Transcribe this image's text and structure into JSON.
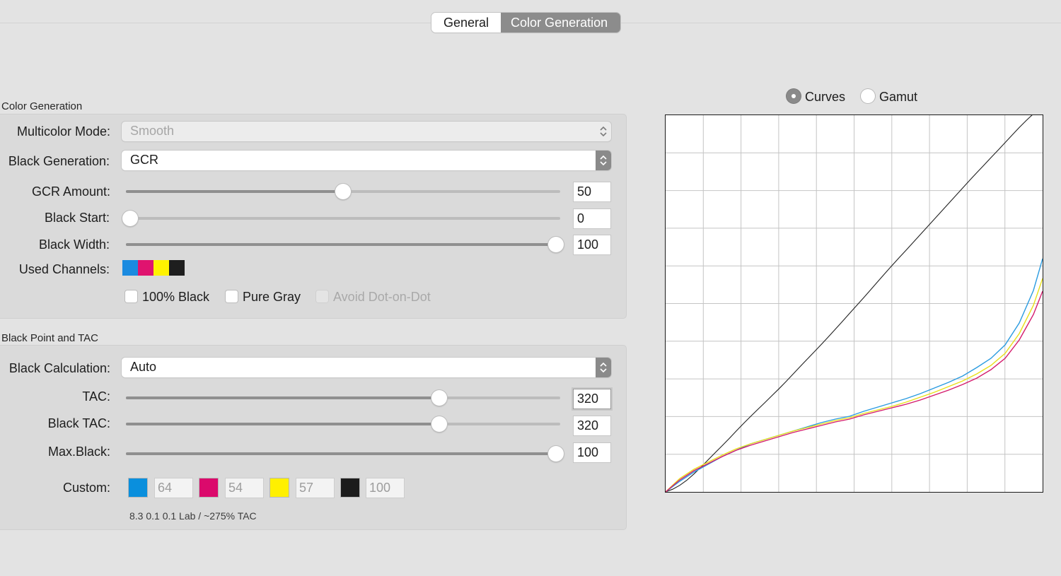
{
  "tabs": [
    {
      "label": "General",
      "active": false
    },
    {
      "label": "Color Generation",
      "active": true
    }
  ],
  "color_generation": {
    "title": "Color Generation",
    "multicolor_mode": {
      "label": "Multicolor Mode:",
      "value": "Smooth",
      "enabled": false
    },
    "black_generation": {
      "label": "Black Generation:",
      "value": "GCR"
    },
    "gcr_amount": {
      "label": "GCR Amount:",
      "value": "50",
      "level": 0.5
    },
    "black_start": {
      "label": "Black Start:",
      "value": "0",
      "level": 0.0
    },
    "black_width": {
      "label": "Black Width:",
      "value": "100",
      "level": 1.0
    },
    "used_channels": {
      "label": "Used Channels:",
      "colors": [
        "#1b8be0",
        "#e0136f",
        "#fff200",
        "#1e1e1e"
      ]
    },
    "checkboxes": [
      {
        "label": "100% Black",
        "checked": false,
        "enabled": true
      },
      {
        "label": "Pure Gray",
        "checked": false,
        "enabled": true
      },
      {
        "label": "Avoid Dot-on-Dot",
        "checked": false,
        "enabled": false
      }
    ]
  },
  "black_point": {
    "title": "Black Point and TAC",
    "black_calculation": {
      "label": "Black Calculation:",
      "value": "Auto"
    },
    "tac": {
      "label": "TAC:",
      "value": "320",
      "level": 0.726
    },
    "black_tac": {
      "label": "Black TAC:",
      "value": "320",
      "level": 0.726
    },
    "max_black": {
      "label": "Max.Black:",
      "value": "100",
      "level": 1.0
    },
    "custom": {
      "label": "Custom:",
      "channels": [
        {
          "name": "cyan",
          "color": "#0a8fdd",
          "value": "64"
        },
        {
          "name": "magenta",
          "color": "#db0a6c",
          "value": "54"
        },
        {
          "name": "yellow",
          "color": "#fff000",
          "value": "57"
        },
        {
          "name": "black",
          "color": "#1c1c1c",
          "value": "100"
        }
      ]
    },
    "note": "8.3 0.1 0.1 Lab / ~275% TAC"
  },
  "view_mode": {
    "options": [
      {
        "label": "Curves",
        "selected": true
      },
      {
        "label": "Gamut",
        "selected": false
      }
    ]
  },
  "curves_graph": {
    "grid_divisions": 10,
    "series": [
      {
        "color": "#222222",
        "points": [
          [
            0,
            0
          ],
          [
            10,
            3.8
          ],
          [
            20,
            9.3
          ],
          [
            30,
            16.5
          ],
          [
            40,
            25.3
          ],
          [
            50,
            35
          ],
          [
            60,
            45.2
          ],
          [
            70,
            55.4
          ],
          [
            80,
            65.4
          ],
          [
            90,
            75.6
          ],
          [
            100,
            86.2
          ],
          [
            110,
            96.6
          ],
          [
            120,
            106.6
          ],
          [
            130,
            116.4
          ],
          [
            140,
            126
          ],
          [
            150,
            135.9
          ],
          [
            160,
            145.7
          ],
          [
            170,
            155.9
          ],
          [
            180,
            166.5
          ],
          [
            190,
            177.1
          ],
          [
            200,
            187.6
          ],
          [
            210,
            198
          ],
          [
            220,
            208.5
          ],
          [
            230,
            219.3
          ],
          [
            240,
            230.3
          ],
          [
            250,
            241.3
          ],
          [
            260,
            252.5
          ],
          [
            270,
            263.6
          ],
          [
            280,
            274.8
          ],
          [
            290,
            286.1
          ],
          [
            300,
            297.6
          ],
          [
            310,
            309
          ],
          [
            320,
            320.3
          ],
          [
            330,
            331.2
          ],
          [
            340,
            342
          ],
          [
            350,
            353
          ],
          [
            360,
            364
          ],
          [
            370,
            375
          ],
          [
            380,
            386
          ],
          [
            390,
            397
          ],
          [
            400,
            408
          ],
          [
            410,
            419
          ],
          [
            420,
            430
          ],
          [
            430,
            441
          ],
          [
            440,
            451.7
          ],
          [
            450,
            462.3
          ],
          [
            460,
            473
          ],
          [
            470,
            483.5
          ],
          [
            480,
            494.2
          ],
          [
            490,
            505
          ],
          [
            500,
            515.6
          ],
          [
            510,
            525.6
          ],
          [
            520,
            535
          ]
        ]
      },
      {
        "color": "#2a9be0",
        "points": [
          [
            0,
            0
          ],
          [
            20,
            15
          ],
          [
            40,
            28
          ],
          [
            60,
            39
          ],
          [
            80,
            50
          ],
          [
            100,
            59
          ],
          [
            120,
            68
          ],
          [
            140,
            74
          ],
          [
            160,
            80
          ],
          [
            180,
            86
          ],
          [
            200,
            92
          ],
          [
            220,
            98
          ],
          [
            240,
            103
          ],
          [
            260,
            107
          ],
          [
            280,
            114
          ],
          [
            300,
            120
          ],
          [
            320,
            126
          ],
          [
            340,
            132
          ],
          [
            360,
            139
          ],
          [
            380,
            147
          ],
          [
            400,
            155
          ],
          [
            420,
            164
          ],
          [
            440,
            176
          ],
          [
            460,
            189
          ],
          [
            480,
            208
          ],
          [
            500,
            239
          ],
          [
            520,
            285
          ],
          [
            533,
            330
          ]
        ]
      },
      {
        "color": "#e8e01a",
        "points": [
          [
            0,
            0
          ],
          [
            20,
            19
          ],
          [
            40,
            32
          ],
          [
            60,
            42
          ],
          [
            80,
            52
          ],
          [
            100,
            61
          ],
          [
            120,
            68
          ],
          [
            140,
            74
          ],
          [
            160,
            80
          ],
          [
            180,
            86
          ],
          [
            200,
            91
          ],
          [
            220,
            96
          ],
          [
            240,
            101
          ],
          [
            260,
            105
          ],
          [
            280,
            111
          ],
          [
            300,
            116
          ],
          [
            320,
            121
          ],
          [
            340,
            127
          ],
          [
            360,
            134
          ],
          [
            380,
            141
          ],
          [
            400,
            149
          ],
          [
            420,
            157
          ],
          [
            440,
            167
          ],
          [
            460,
            179
          ],
          [
            480,
            196
          ],
          [
            500,
            224
          ],
          [
            520,
            264
          ],
          [
            533,
            302
          ]
        ]
      },
      {
        "color": "#d41a6c",
        "points": [
          [
            0,
            0
          ],
          [
            20,
            17
          ],
          [
            40,
            30
          ],
          [
            60,
            40
          ],
          [
            80,
            50
          ],
          [
            100,
            59
          ],
          [
            120,
            66
          ],
          [
            140,
            72
          ],
          [
            160,
            78
          ],
          [
            180,
            84
          ],
          [
            200,
            89
          ],
          [
            220,
            94
          ],
          [
            240,
            99
          ],
          [
            260,
            103
          ],
          [
            280,
            109
          ],
          [
            300,
            114
          ],
          [
            320,
            119
          ],
          [
            340,
            124
          ],
          [
            360,
            130
          ],
          [
            380,
            137
          ],
          [
            400,
            144
          ],
          [
            420,
            152
          ],
          [
            440,
            161
          ],
          [
            460,
            173
          ],
          [
            480,
            189
          ],
          [
            500,
            215
          ],
          [
            520,
            251
          ],
          [
            533,
            284
          ]
        ]
      }
    ]
  }
}
